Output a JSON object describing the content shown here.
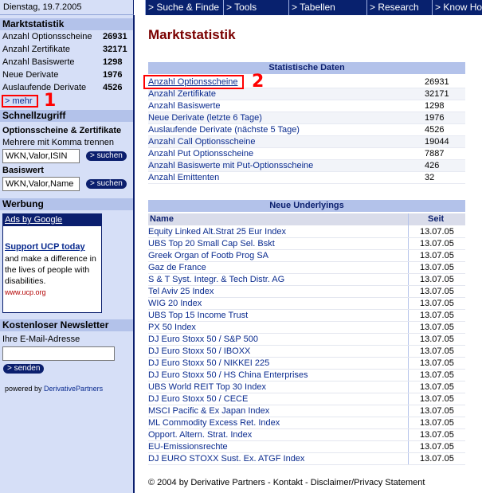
{
  "topbar": {
    "date": "Dienstag, 19.7.2005",
    "nav": [
      "> Suche & Finde",
      "> Tools",
      "> Tabellen",
      "> Research",
      "> Know How"
    ]
  },
  "sidebar": {
    "marktstatistik": {
      "title": "Marktstatistik",
      "items": [
        {
          "label": "Anzahl Optionsscheine",
          "value": "26931"
        },
        {
          "label": "Anzahl Zertifikate",
          "value": "32171"
        },
        {
          "label": "Anzahl Basiswerte",
          "value": "1298"
        },
        {
          "label": "Neue Derivate",
          "value": "1976"
        },
        {
          "label": "Auslaufende Derivate",
          "value": "4526"
        }
      ],
      "more_link": "> mehr"
    },
    "annotation_1": "1",
    "schnellzugriff": {
      "title": "Schnellzugriff",
      "sub1": "Optionsscheine & Zertifikate",
      "hint": "Mehrere mit Komma trennen",
      "input1_value": "WKN,Valor,ISIN",
      "search_label": "> suchen",
      "sub2": "Basiswert",
      "input2_value": "WKN,Valor,Name"
    },
    "werbung": {
      "title": "Werbung",
      "ad_header": "Ads by Google",
      "ad_title": "Support UCP today",
      "ad_body": "and make a difference in the lives of people with disabilities.",
      "ad_url": "www.ucp.org"
    },
    "newsletter": {
      "title": "Kostenloser Newsletter",
      "email_label": "Ihre E-Mail-Adresse",
      "send_label": "> senden"
    },
    "powered_prefix": "powered by",
    "powered_name": "DerivativePartners"
  },
  "main": {
    "title": "Marktstatistik",
    "annotation_2": "2",
    "stats_header": "Statistische Daten",
    "stats": [
      {
        "label": "Anzahl Optionsscheine",
        "value": "26931"
      },
      {
        "label": "Anzahl Zertifikate",
        "value": "32171"
      },
      {
        "label": "Anzahl Basiswerte",
        "value": "1298"
      },
      {
        "label": "Neue Derivate (letzte 6 Tage)",
        "value": "1976"
      },
      {
        "label": "Auslaufende Derivate (nächste 5 Tage)",
        "value": "4526"
      },
      {
        "label": "Anzahl Call Optionsscheine",
        "value": "19044"
      },
      {
        "label": "Anzahl Put Optionsscheine",
        "value": "7887"
      },
      {
        "label": "Anzahl Basiswerte mit Put-Optionsscheine",
        "value": "426"
      },
      {
        "label": "Anzahl Emittenten",
        "value": "32"
      }
    ],
    "underlyings_header": "Neue Underlyings",
    "col_name": "Name",
    "col_since": "Seit",
    "underlyings": [
      {
        "name": "Equity Linked Alt.Strat 25 Eur Index",
        "since": "13.07.05"
      },
      {
        "name": "UBS Top 20 Small Cap Sel. Bskt",
        "since": "13.07.05"
      },
      {
        "name": "Greek Organ of Footb Prog SA",
        "since": "13.07.05"
      },
      {
        "name": "Gaz de France",
        "since": "13.07.05"
      },
      {
        "name": "S & T Syst. Integr. & Tech Distr. AG",
        "since": "13.07.05"
      },
      {
        "name": "Tel Aviv 25 Index",
        "since": "13.07.05"
      },
      {
        "name": "WIG 20 Index",
        "since": "13.07.05"
      },
      {
        "name": "UBS Top 15 Income Trust",
        "since": "13.07.05"
      },
      {
        "name": "PX 50 Index",
        "since": "13.07.05"
      },
      {
        "name": "DJ Euro Stoxx 50 / S&P 500",
        "since": "13.07.05"
      },
      {
        "name": "DJ Euro Stoxx 50 / IBOXX",
        "since": "13.07.05"
      },
      {
        "name": "DJ Euro Stoxx 50 / NIKKEI 225",
        "since": "13.07.05"
      },
      {
        "name": "DJ Euro Stoxx 50 / HS China Enterprises",
        "since": "13.07.05"
      },
      {
        "name": "UBS World REIT Top 30 Index",
        "since": "13.07.05"
      },
      {
        "name": "DJ Euro Stoxx 50 / CECE",
        "since": "13.07.05"
      },
      {
        "name": "MSCI Pacific & Ex Japan Index",
        "since": "13.07.05"
      },
      {
        "name": "ML Commodity Excess Ret. Index",
        "since": "13.07.05"
      },
      {
        "name": "Opport. Altern. Strat. Index",
        "since": "13.07.05"
      },
      {
        "name": "EU-Emissionsrechte",
        "since": "13.07.05"
      },
      {
        "name": "DJ EURO STOXX Sust. Ex. ATGF Index",
        "since": "13.07.05"
      }
    ]
  },
  "footer": {
    "copyright": "© 2004 by Derivative Partners",
    "sep": " - ",
    "kontakt": "Kontakt",
    "disclaimer": "Disclaimer/Privacy Statement"
  },
  "colors": {
    "navy": "#08216e",
    "sidebar_bg": "#d6dff7",
    "header_bg": "#b3c2ea",
    "title_red": "#7a0000",
    "link_blue": "#0a2b8f",
    "annotation_red": "#ff0000"
  }
}
